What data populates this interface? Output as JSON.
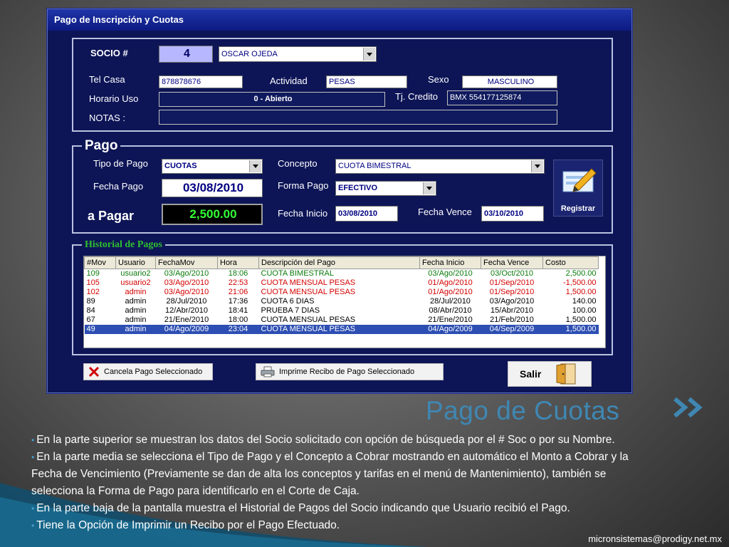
{
  "window": {
    "title": "Pago de Inscripción y Cuotas"
  },
  "socio": {
    "socio_label": "SOCIO   #",
    "socio_number": "4",
    "name": "OSCAR OJEDA",
    "tel_label": "Tel  Casa",
    "tel_value": "878878676",
    "actividad_label": "Actividad",
    "actividad_value": "PESAS",
    "sexo_label": "Sexo",
    "sexo_value": "MASCULINO",
    "horario_label": "Horario Uso",
    "horario_value": "0 - Abierto",
    "tj_label": "Tj. Credito",
    "tj_value": "BMX 554177125874",
    "notas_label": "NOTAS :",
    "notas_value": ""
  },
  "pago": {
    "legend": "Pago",
    "tipo_label": "Tipo de Pago",
    "tipo_value": "CUOTAS",
    "concepto_label": "Concepto",
    "concepto_value": "CUOTA BIMESTRAL",
    "fecha_label": "Fecha Pago",
    "fecha_value": "03/08/2010",
    "forma_label": "Forma Pago",
    "forma_value": "EFECTIVO",
    "apagar_label": "a Pagar",
    "apagar_value": "2,500.00",
    "fecha_inicio_label": "Fecha Inicio",
    "fecha_inicio_value": "03/08/2010",
    "fecha_vence_label": "Fecha Vence",
    "fecha_vence_value": "03/10/2010",
    "registrar_label": "Registrar"
  },
  "historial": {
    "legend": "Historial de Pagos",
    "columns": [
      "#Mov",
      "Usuario",
      "FechaMov",
      "Hora",
      "Descripción del Pago",
      "Fecha Inicio",
      "Fecha Vence",
      "Costo"
    ],
    "rows": [
      [
        "109",
        "usuario2",
        "03/Ago/2010",
        "18:06",
        "CUOTA BIMESTRAL",
        "03/Ago/2010",
        "03/Oct/2010",
        "2,500.00"
      ],
      [
        "105",
        "usuario2",
        "03/Ago/2010",
        "22:53",
        "CUOTA MENSUAL PESAS",
        "01/Ago/2010",
        "01/Sep/2010",
        "-1,500.00"
      ],
      [
        "102",
        "admin",
        "03/Ago/2010",
        "21:06",
        "CUOTA MENSUAL PESAS",
        "01/Ago/2010",
        "01/Sep/2010",
        "1,500.00"
      ],
      [
        "89",
        "admin",
        "28/Jul/2010",
        "17:36",
        "CUOTA 6 DIAS",
        "28/Jul/2010",
        "03/Ago/2010",
        "140.00"
      ],
      [
        "84",
        "admin",
        "12/Abr/2010",
        "18:41",
        "PRUEBA 7 DIAS",
        "08/Abr/2010",
        "15/Abr/2010",
        "100.00"
      ],
      [
        "67",
        "admin",
        "21/Ene/2010",
        "18:00",
        "CUOTA MENSUAL PESAS",
        "21/Ene/2010",
        "21/Feb/2010",
        "1,500.00"
      ],
      [
        "49",
        "admin",
        "04/Ago/2009",
        "23:04",
        "CUOTA MENSUAL PESAS",
        "04/Ago/2009",
        "04/Sep/2009",
        "1,500.00"
      ]
    ]
  },
  "buttons": {
    "cancel": "Cancela Pago Seleccionado",
    "print": "Imprime Recibo de Pago Seleccionado",
    "exit": "Salir"
  },
  "slide": {
    "title": "Pago de Cuotas",
    "bullets": [
      "En la parte superior se muestran los datos del Socio solicitado con opción de búsqueda por el # Soc  o por su Nombre.",
      "En la parte media se selecciona el Tipo de Pago y el Concepto a Cobrar mostrando en automático el Monto a Cobrar y la Fecha de Vencimiento (Previamente se dan de alta los conceptos y tarifas en el menú de Mantenimiento),  también se selecciona la Forma de Pago para identificarlo en el Corte de Caja.",
      "En la parte baja de la pantalla muestra el Historial de Pagos  del Socio indicando que Usuario recibió el Pago.",
      "Tiene la Opción de Imprimir un Recibo por el Pago Efectuado."
    ],
    "email": "micronsistemas@prodigy.net.mx"
  },
  "colors": {
    "window_bg": "#0d1557",
    "title_accent": "#3f87b3",
    "legend_historial": "#2fbf2f",
    "amount_green": "#33ff33",
    "selected_row": "#2d4fb3"
  }
}
